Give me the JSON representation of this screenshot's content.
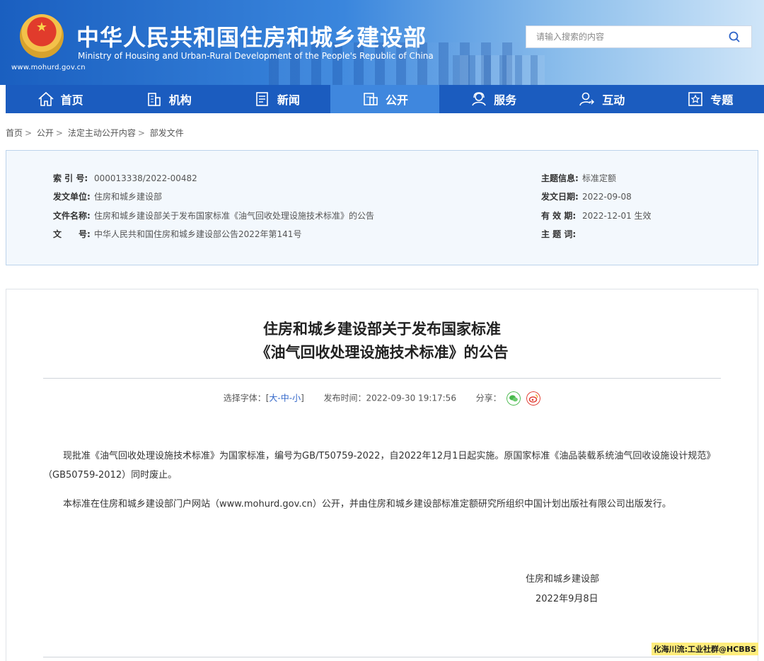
{
  "header": {
    "title_cn": "中华人民共和国住房和城乡建设部",
    "title_en": "Ministry of Housing and Urban-Rural Development of the People's Republic of China",
    "site_url": "www.mohurd.gov.cn",
    "search_placeholder": "请输入搜索的内容"
  },
  "nav": [
    {
      "label": "首页",
      "icon": "home-icon"
    },
    {
      "label": "机构",
      "icon": "building-icon"
    },
    {
      "label": "新闻",
      "icon": "news-icon"
    },
    {
      "label": "公开",
      "icon": "disclosure-icon",
      "active": true
    },
    {
      "label": "服务",
      "icon": "service-icon"
    },
    {
      "label": "互动",
      "icon": "interact-icon"
    },
    {
      "label": "专题",
      "icon": "topic-icon"
    }
  ],
  "breadcrumb": [
    "首页",
    "公开",
    "法定主动公开内容",
    "部发文件"
  ],
  "info": {
    "index_label": "索 引 号:",
    "index_value": "000013338/2022-00482",
    "issuer_label": "发文单位:",
    "issuer_value": "住房和城乡建设部",
    "docname_label": "文件名称:",
    "docname_value": "住房和城乡建设部关于发布国家标准《油气回收处理设施技术标准》的公告",
    "docno_label": "文　　号:",
    "docno_value": "中华人民共和国住房和城乡建设部公告2022年第141号",
    "topic_label": "主题信息:",
    "topic_value": "标准定额",
    "date_label": "发文日期:",
    "date_value": "2022-09-08",
    "valid_label": "有 效 期:",
    "valid_value": "2022-12-01 生效",
    "keyword_label": "主 题 词:",
    "keyword_value": ""
  },
  "article": {
    "title_line1": "住房和城乡建设部关于发布国家标准",
    "title_line2": "《油气回收处理设施技术标准》的公告",
    "font_label": "选择字体：[",
    "font_large": "大",
    "font_mid": "中",
    "font_small": "小",
    "font_dash": "-",
    "font_close": "]",
    "publish_label": "发布时间：",
    "publish_time": "2022-09-30 19:17:56",
    "share_label": "分享：",
    "para1": "现批准《油气回收处理设施技术标准》为国家标准，编号为GB/T50759-2022，自2022年12月1日起实施。原国家标准《油品装载系统油气回收设施设计规范》（GB50759-2012）同时废止。",
    "para2": "本标准在住房和城乡建设部门户网站（www.mohurd.gov.cn）公开，并由住房和城乡建设部标准定额研究所组织中国计划出版社有限公司出版发行。",
    "sign_org": "住房和城乡建设部",
    "sign_date": "2022年9月8日"
  },
  "watermark": "化海川流:工业社群@HCBBS",
  "colors": {
    "nav": "#1b5cbf",
    "nav_active": "#3f87de",
    "link": "#2d63c8"
  }
}
